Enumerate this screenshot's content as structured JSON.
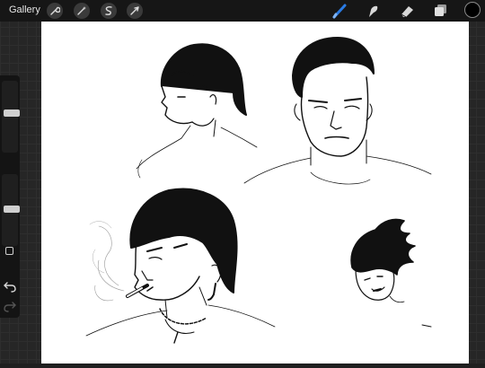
{
  "app": {
    "gallery_label": "Gallery"
  },
  "colors": {
    "canvas": "#ffffff",
    "accent": "#2a7be4",
    "toolbar": "#161616",
    "ink": "#111111",
    "current_color": "#000000"
  },
  "toolbar": {
    "left_tools": [
      "wrench-icon",
      "magic-wand-icon",
      "selection-icon",
      "transform-arrow-icon"
    ],
    "right_tools": [
      "brush-icon",
      "smudge-icon",
      "eraser-icon",
      "layers-icon"
    ],
    "active_tool": "brush-icon"
  },
  "sidebar": {
    "brush_size_level": 0.56,
    "opacity_level": 0.52
  }
}
